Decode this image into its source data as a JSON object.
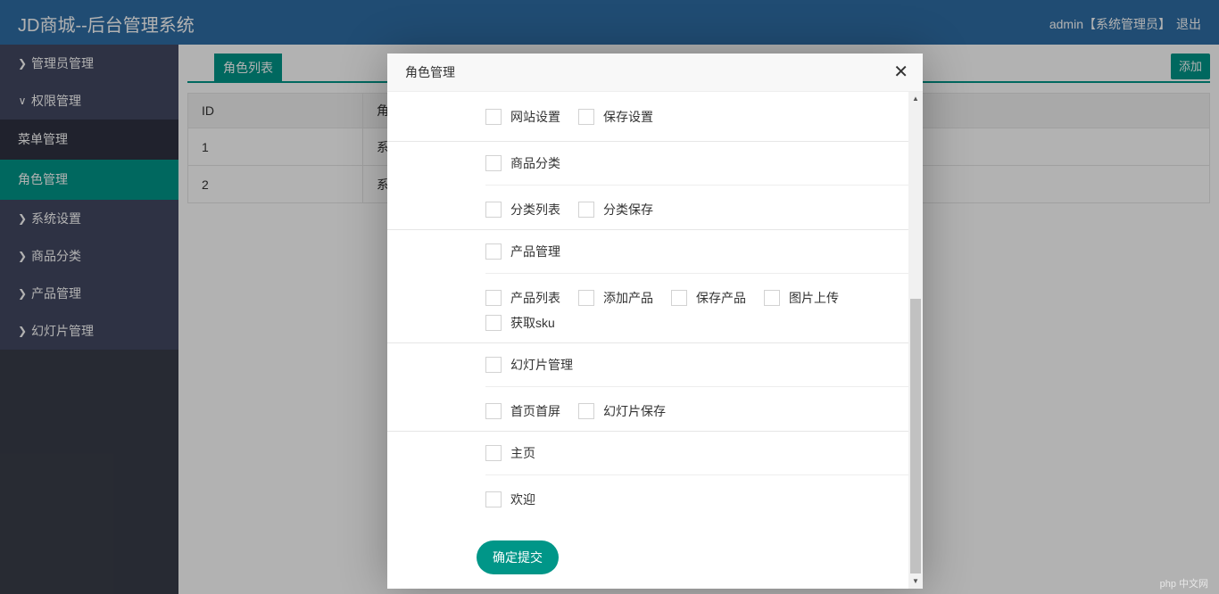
{
  "header": {
    "brand": "JD商城--后台管理系统",
    "user": "admin【系统管理员】",
    "logout": "退出"
  },
  "sidebar": {
    "items": [
      {
        "label": "管理员管理",
        "expanded": false
      },
      {
        "label": "权限管理",
        "expanded": true
      },
      {
        "label": "系统设置",
        "expanded": false
      },
      {
        "label": "商品分类",
        "expanded": false
      },
      {
        "label": "产品管理",
        "expanded": false
      },
      {
        "label": "幻灯片管理",
        "expanded": false
      }
    ],
    "subitems": [
      {
        "label": "菜单管理",
        "active": false
      },
      {
        "label": "角色管理",
        "active": true
      }
    ]
  },
  "main": {
    "tab": "角色列表",
    "add_button": "添加",
    "table": {
      "headers": [
        "ID",
        "角"
      ],
      "rows": [
        [
          "1",
          "系"
        ],
        [
          "2",
          "系"
        ]
      ]
    }
  },
  "modal": {
    "title": "角色管理",
    "groups": [
      {
        "children": [
          "网站设置",
          "保存设置"
        ]
      },
      {
        "parent": "商品分类",
        "children": [
          "分类列表",
          "分类保存"
        ]
      },
      {
        "parent": "产品管理",
        "children": [
          "产品列表",
          "添加产品",
          "保存产品",
          "图片上传",
          "获取sku"
        ]
      },
      {
        "parent": "幻灯片管理",
        "children": [
          "首页首屏",
          "幻灯片保存"
        ]
      },
      {
        "parent": "主页",
        "children": [
          "欢迎"
        ]
      }
    ],
    "submit": "确定提交"
  },
  "watermark": "php 中文网",
  "colors": {
    "topbar": "#2f6ea5",
    "accent": "#009688",
    "sidebar": "#393d49"
  }
}
